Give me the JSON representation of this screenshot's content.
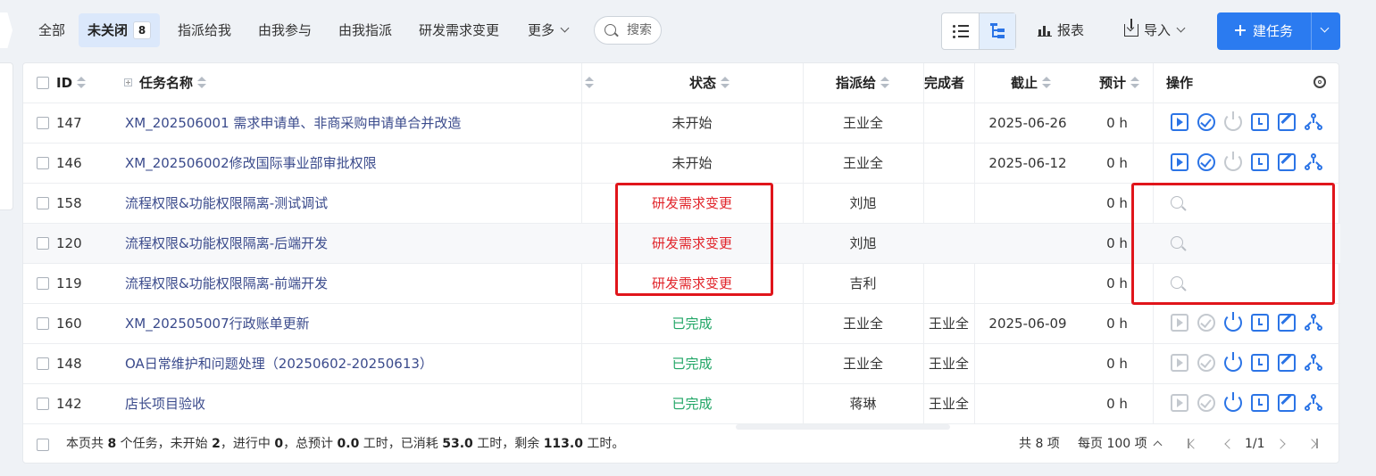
{
  "tabs": {
    "all": "全部",
    "unclosed": "未关闭",
    "unclosed_count": "8",
    "assigned_to_me": "指派给我",
    "involved": "由我参与",
    "assigned_by_me": "由我指派",
    "rd_change": "研发需求变更",
    "more": "更多"
  },
  "search": {
    "placeholder": "搜索"
  },
  "toolbar": {
    "report": "报表",
    "import": "导入",
    "create": "建任务"
  },
  "table": {
    "headers": {
      "id": "ID",
      "name": "任务名称",
      "status": "状态",
      "assignee": "指派给",
      "finisher": "完成者",
      "deadline": "截止",
      "estimate": "预计",
      "actions": "操作"
    },
    "rows": [
      {
        "id": "147",
        "name": "XM_202506001 需求申请单、非商采购申请单合并改造",
        "status": "未开始",
        "status_color": "#333333",
        "assignee": "王业全",
        "finisher": "",
        "deadline": "2025-06-26",
        "estimate": "0 h",
        "actions": "full"
      },
      {
        "id": "146",
        "name": "XM_202506002修改国际事业部审批权限",
        "status": "未开始",
        "status_color": "#333333",
        "assignee": "王业全",
        "finisher": "",
        "deadline": "2025-06-12",
        "estimate": "0 h",
        "actions": "full"
      },
      {
        "id": "158",
        "name": "流程权限&功能权限隔离-测试调试",
        "status": "研发需求变更",
        "status_color": "#e1252b",
        "assignee": "刘旭",
        "finisher": "",
        "deadline": "",
        "estimate": "0 h",
        "actions": "search-only"
      },
      {
        "id": "120",
        "name": "流程权限&功能权限隔离-后端开发",
        "status": "研发需求变更",
        "status_color": "#e1252b",
        "assignee": "刘旭",
        "finisher": "",
        "deadline": "",
        "estimate": "0 h",
        "actions": "search-only"
      },
      {
        "id": "119",
        "name": "流程权限&功能权限隔离-前端开发",
        "status": "研发需求变更",
        "status_color": "#e1252b",
        "assignee": "吉利",
        "finisher": "",
        "deadline": "",
        "estimate": "0 h",
        "actions": "search-only"
      },
      {
        "id": "160",
        "name": "XM_202505007行政账单更新",
        "status": "已完成",
        "status_color": "#1fa565",
        "assignee": "王业全",
        "finisher": "王业全",
        "deadline": "2025-06-09",
        "estimate": "0 h",
        "actions": "done"
      },
      {
        "id": "148",
        "name": "OA日常维护和问题处理（20250602-20250613）",
        "status": "已完成",
        "status_color": "#1fa565",
        "assignee": "王业全",
        "finisher": "王业全",
        "deadline": "",
        "estimate": "0 h",
        "actions": "done"
      },
      {
        "id": "142",
        "name": "店长项目验收",
        "status": "已完成",
        "status_color": "#1fa565",
        "assignee": "蒋琳",
        "finisher": "王业全",
        "deadline": "",
        "estimate": "0 h",
        "actions": "done"
      }
    ]
  },
  "footer": {
    "s1": "本页共 ",
    "n1": "8",
    "s2": " 个任务，未开始 ",
    "n2": "2",
    "s3": "，进行中 ",
    "n3": "0",
    "s4": "，总预计 ",
    "n4": "0.0",
    "s5": " 工时，已消耗 ",
    "n5": "53.0",
    "s6": " 工时，剩余 ",
    "n6": "113.0",
    "s7": " 工时。",
    "total": "共 8 项",
    "per_page": "每页 100 项",
    "page": "1/1"
  },
  "colors": {
    "accent": "#2b7bf0",
    "changed": "#e1252b",
    "done": "#1fa565",
    "annotation": "#e0151b"
  }
}
